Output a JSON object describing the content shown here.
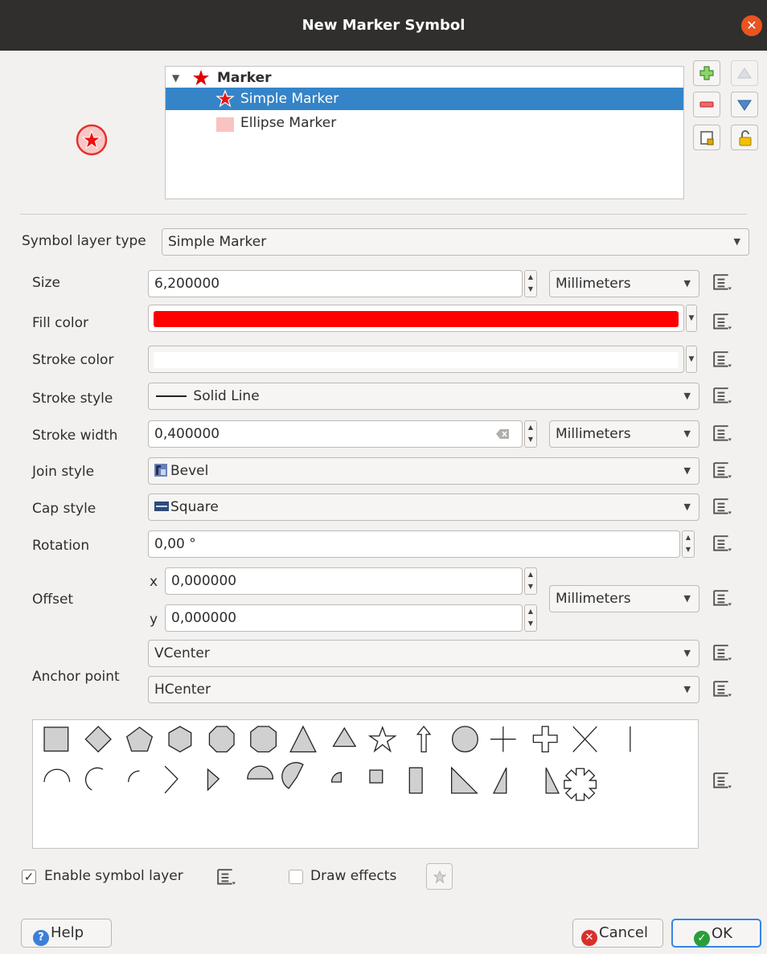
{
  "window": {
    "title": "New Marker Symbol"
  },
  "tree": {
    "items": [
      {
        "label": "Marker"
      },
      {
        "label": "Simple Marker"
      },
      {
        "label": "Ellipse Marker"
      }
    ]
  },
  "symbol_layer_type": {
    "label": "Symbol layer type",
    "value": "Simple Marker"
  },
  "form": {
    "size": {
      "label": "Size",
      "value": "6,200000",
      "unit": "Millimeters"
    },
    "fill_color": {
      "label": "Fill color",
      "color": "#ff0000"
    },
    "stroke_color": {
      "label": "Stroke color",
      "color": "#ffffff"
    },
    "stroke_style": {
      "label": "Stroke style",
      "value": "Solid Line"
    },
    "stroke_width": {
      "label": "Stroke width",
      "value": "0,400000",
      "unit": "Millimeters"
    },
    "join_style": {
      "label": "Join style",
      "value": "Bevel"
    },
    "cap_style": {
      "label": "Cap style",
      "value": "Square"
    },
    "rotation": {
      "label": "Rotation",
      "value": "0,00 °"
    },
    "offset": {
      "label": "Offset",
      "x_label": "x",
      "x_value": "0,000000",
      "y_label": "y",
      "y_value": "0,000000",
      "unit": "Millimeters"
    },
    "anchor": {
      "label": "Anchor point",
      "vertical": "VCenter",
      "horizontal": "HCenter"
    }
  },
  "shapes": [
    "square",
    "diamond",
    "pentagon",
    "hexagon",
    "octagon",
    "decagon",
    "triangle",
    "equilateral-triangle",
    "star",
    "arrow",
    "circle",
    "cross",
    "cross-fill",
    "cross2",
    "line",
    "semi-arc",
    "third-arc",
    "quarter-arc",
    "arrowhead",
    "filled-arrowhead",
    "half-circle",
    "third-circle",
    "quarter-circle",
    "quarter-square",
    "half-square",
    "diagonal-half-square",
    "right-half-triangle",
    "left-half-triangle",
    "asterisk-fill"
  ],
  "bottom": {
    "enable_layer": {
      "label": "Enable symbol layer",
      "checked": true
    },
    "draw_effects": {
      "label": "Draw effects",
      "checked": false
    }
  },
  "buttons": {
    "help": "Help",
    "cancel": "Cancel",
    "ok": "OK"
  },
  "colors": {
    "accent": "#3584c8",
    "titlebar": "#302f2d",
    "close": "#e95420",
    "marker_red": "#ff0000"
  }
}
